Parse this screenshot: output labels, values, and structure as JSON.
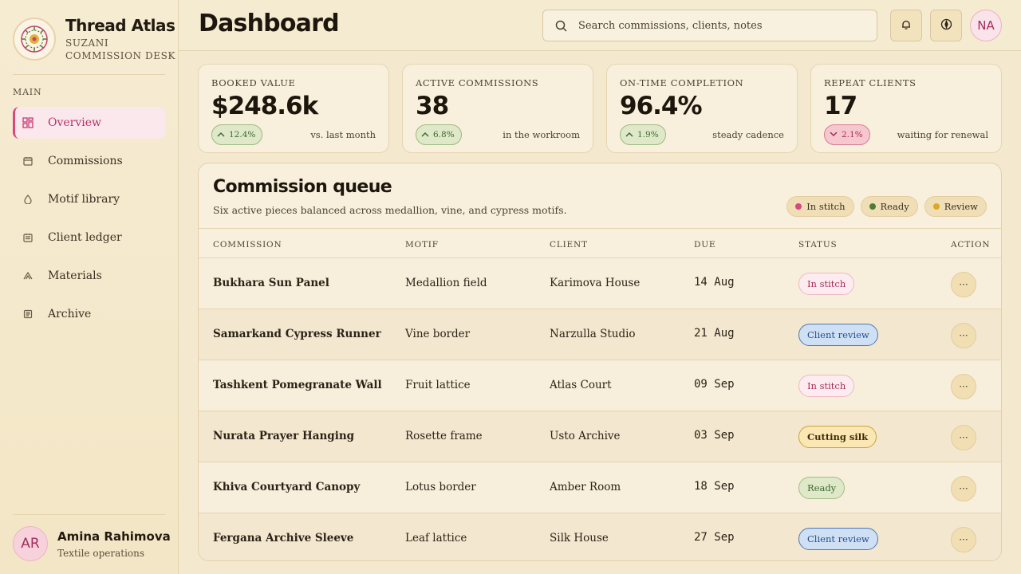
{
  "brand": {
    "name": "Thread Atlas",
    "subtitle": "SUZANI COMMISSION DESK"
  },
  "sidebar": {
    "section_label": "MAIN",
    "items": [
      {
        "label": "Overview",
        "icon": "dashboard-grid-icon",
        "active": true
      },
      {
        "label": "Commissions",
        "icon": "calendar-icon",
        "active": false
      },
      {
        "label": "Motif library",
        "icon": "droplet-icon",
        "active": false
      },
      {
        "label": "Client ledger",
        "icon": "ledger-icon",
        "active": false
      },
      {
        "label": "Materials",
        "icon": "tent-icon",
        "active": false
      },
      {
        "label": "Archive",
        "icon": "archive-icon",
        "active": false
      }
    ],
    "user": {
      "initials": "AR",
      "name": "Amina Rahimova",
      "role": "Textile operations"
    }
  },
  "header": {
    "title": "Dashboard",
    "search_placeholder": "Search commissions, clients, notes",
    "user_initials": "NA",
    "icons": [
      "search-icon",
      "bell-icon",
      "compass-icon"
    ]
  },
  "kpis": [
    {
      "label": "BOOKED VALUE",
      "value": "$248.6k",
      "delta": "12.4%",
      "direction": "up",
      "note": "vs. last month"
    },
    {
      "label": "ACTIVE COMMISSIONS",
      "value": "38",
      "delta": "6.8%",
      "direction": "up",
      "note": "in the workroom"
    },
    {
      "label": "ON-TIME COMPLETION",
      "value": "96.4%",
      "delta": "1.9%",
      "direction": "up",
      "note": "steady cadence"
    },
    {
      "label": "REPEAT CLIENTS",
      "value": "17",
      "delta": "2.1%",
      "direction": "down",
      "note": "waiting for renewal"
    }
  ],
  "queue": {
    "title": "Commission queue",
    "subtitle": "Six active pieces balanced across medallion, vine, and cypress motifs.",
    "legend": [
      {
        "label": "In stitch",
        "color": "#d44a7c"
      },
      {
        "label": "Ready",
        "color": "#4f7a37"
      },
      {
        "label": "Review",
        "color": "#dba72c"
      }
    ],
    "columns": [
      "COMMISSION",
      "MOTIF",
      "CLIENT",
      "DUE",
      "STATUS",
      "ACTION"
    ],
    "rows": [
      {
        "commission": "Bukhara Sun Panel",
        "motif": "Medallion field",
        "client": "Karimova House",
        "due": "14 Aug",
        "status": "In stitch",
        "status_kind": "stitch"
      },
      {
        "commission": "Samarkand Cypress Runner",
        "motif": "Vine border",
        "client": "Narzulla Studio",
        "due": "21 Aug",
        "status": "Client review",
        "status_kind": "review"
      },
      {
        "commission": "Tashkent Pomegranate Wall",
        "motif": "Fruit lattice",
        "client": "Atlas Court",
        "due": "09 Sep",
        "status": "In stitch",
        "status_kind": "stitch"
      },
      {
        "commission": "Nurata Prayer Hanging",
        "motif": "Rosette frame",
        "client": "Usto Archive",
        "due": "03 Sep",
        "status": "Cutting silk",
        "status_kind": "cut"
      },
      {
        "commission": "Khiva Courtyard Canopy",
        "motif": "Lotus border",
        "client": "Amber Room",
        "due": "18 Sep",
        "status": "Ready",
        "status_kind": "ready"
      },
      {
        "commission": "Fergana Archive Sleeve",
        "motif": "Leaf lattice",
        "client": "Silk House",
        "due": "27 Sep",
        "status": "Client review",
        "status_kind": "review"
      }
    ],
    "action_icon": "more-dots-icon"
  },
  "colors": {
    "accent": "#d8487e",
    "background": "#f4e9cf",
    "card": "#f8efdd",
    "positive": "#3f6a2f",
    "negative": "#a52d4e"
  }
}
